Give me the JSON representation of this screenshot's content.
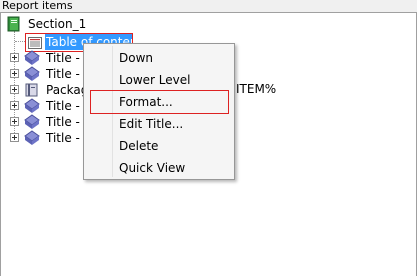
{
  "panel": {
    "title": "Report items"
  },
  "tree": {
    "root": {
      "label": "Section_1",
      "icon": "section-book-icon"
    },
    "selected": {
      "label": "Table of contents",
      "icon": "table-of-contents-icon"
    },
    "children": [
      {
        "label": "Title - P",
        "icon": "title-item-icon"
      },
      {
        "label": "Title - M",
        "icon": "title-item-icon"
      },
      {
        "label": "Packag",
        "icon": "package-item-icon"
      },
      {
        "label": "Title - T",
        "icon": "title-item-icon"
      },
      {
        "label": "Title - R",
        "icon": "title-item-icon"
      },
      {
        "label": "Title - V",
        "icon": "title-item-icon"
      }
    ],
    "trailing_text": "ITEM%"
  },
  "context_menu": {
    "items": [
      {
        "label": "Down"
      },
      {
        "label": "Lower Level"
      },
      {
        "label": "Format..."
      },
      {
        "label": "Edit Title..."
      },
      {
        "label": "Delete"
      },
      {
        "label": "Quick View"
      }
    ],
    "highlighted": "Format..."
  },
  "colors": {
    "selection": "#3399ff",
    "highlight_border": "#dd2222",
    "menu_bg": "#f5f5f5"
  }
}
